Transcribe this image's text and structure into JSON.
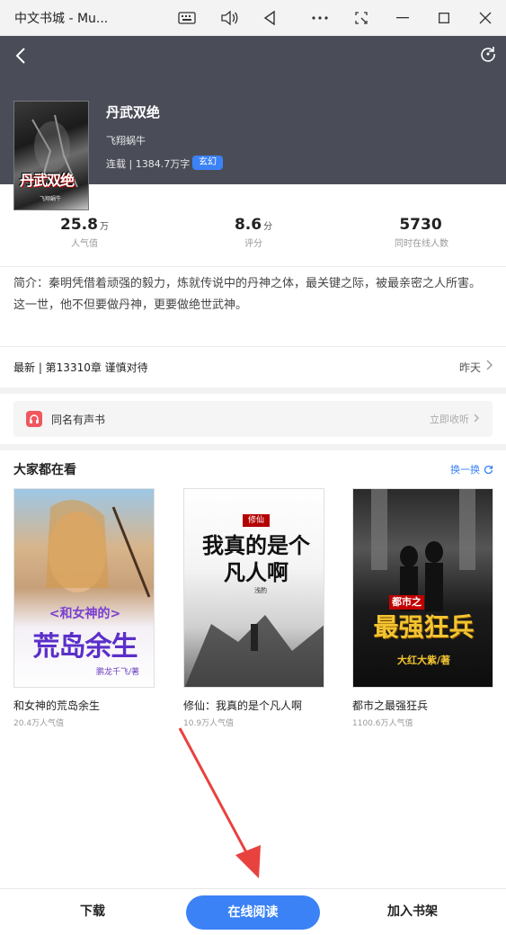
{
  "window": {
    "title": "中文书城 - Mu..."
  },
  "book": {
    "title": "丹武双绝",
    "author": "飞翔蜗牛",
    "meta": "连载 | 1384.7万字",
    "genre": "玄幻",
    "cover_title": "丹武双绝",
    "cover_author": "飞翔蜗牛"
  },
  "stats": [
    {
      "value": "25.8",
      "unit": "万",
      "label": "人气值"
    },
    {
      "value": "8.6",
      "unit": "分",
      "label": "评分"
    },
    {
      "value": "5730",
      "unit": "",
      "label": "同时在线人数"
    }
  ],
  "intro": {
    "line1": "简介：秦明凭借着顽强的毅力，炼就传说中的丹神之体，最关键之际，被最亲密之人所害。",
    "line2": "这一世，他不但要做丹神，更要做绝世武神。"
  },
  "latest": {
    "text": "最新 | 第13310章 谨慎对待",
    "time": "昨天"
  },
  "audio": {
    "label": "同名有声书",
    "action": "立即收听"
  },
  "recommend": {
    "title": "大家都在看",
    "swap": "换一换",
    "books": [
      {
        "name": "和女神的荒岛余生",
        "popularity": "20.4万人气值",
        "cover_top": "<和女神的>",
        "cover_main": "荒岛余生",
        "cover_author": "鹏龙千飞/著"
      },
      {
        "name": "修仙：我真的是个凡人啊",
        "popularity": "10.9万人气值",
        "cover_top": "修仙",
        "cover_main": "我真的是个凡人啊",
        "cover_author": "浅酌"
      },
      {
        "name": "都市之最强狂兵",
        "popularity": "1100.6万人气值",
        "cover_top": "都市之",
        "cover_main": "最强狂兵",
        "cover_author": "大红大紫/著"
      }
    ]
  },
  "bottom": {
    "download": "下载",
    "read": "在线阅读",
    "shelf": "加入书架"
  },
  "colors": {
    "accent": "#3b82f6",
    "header_bg": "#4a4d58",
    "audio_icon": "#f0575f",
    "arrow": "#e8423f"
  }
}
